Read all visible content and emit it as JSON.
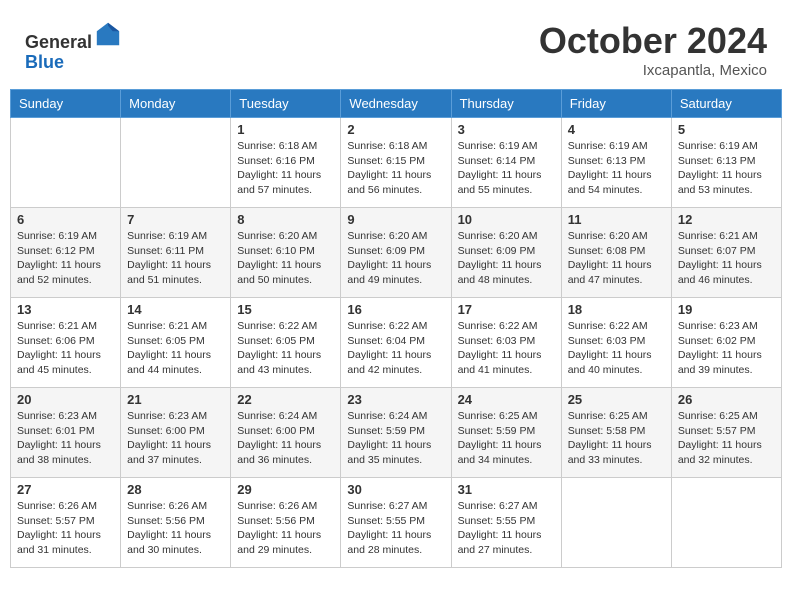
{
  "header": {
    "logo_general": "General",
    "logo_blue": "Blue",
    "month_title": "October 2024",
    "location": "Ixcapantla, Mexico"
  },
  "days_of_week": [
    "Sunday",
    "Monday",
    "Tuesday",
    "Wednesday",
    "Thursday",
    "Friday",
    "Saturday"
  ],
  "weeks": [
    [
      null,
      null,
      {
        "day": "1",
        "sunrise": "6:18 AM",
        "sunset": "6:16 PM",
        "daylight": "11 hours and 57 minutes."
      },
      {
        "day": "2",
        "sunrise": "6:18 AM",
        "sunset": "6:15 PM",
        "daylight": "11 hours and 56 minutes."
      },
      {
        "day": "3",
        "sunrise": "6:19 AM",
        "sunset": "6:14 PM",
        "daylight": "11 hours and 55 minutes."
      },
      {
        "day": "4",
        "sunrise": "6:19 AM",
        "sunset": "6:13 PM",
        "daylight": "11 hours and 54 minutes."
      },
      {
        "day": "5",
        "sunrise": "6:19 AM",
        "sunset": "6:13 PM",
        "daylight": "11 hours and 53 minutes."
      }
    ],
    [
      {
        "day": "6",
        "sunrise": "6:19 AM",
        "sunset": "6:12 PM",
        "daylight": "11 hours and 52 minutes."
      },
      {
        "day": "7",
        "sunrise": "6:19 AM",
        "sunset": "6:11 PM",
        "daylight": "11 hours and 51 minutes."
      },
      {
        "day": "8",
        "sunrise": "6:20 AM",
        "sunset": "6:10 PM",
        "daylight": "11 hours and 50 minutes."
      },
      {
        "day": "9",
        "sunrise": "6:20 AM",
        "sunset": "6:09 PM",
        "daylight": "11 hours and 49 minutes."
      },
      {
        "day": "10",
        "sunrise": "6:20 AM",
        "sunset": "6:09 PM",
        "daylight": "11 hours and 48 minutes."
      },
      {
        "day": "11",
        "sunrise": "6:20 AM",
        "sunset": "6:08 PM",
        "daylight": "11 hours and 47 minutes."
      },
      {
        "day": "12",
        "sunrise": "6:21 AM",
        "sunset": "6:07 PM",
        "daylight": "11 hours and 46 minutes."
      }
    ],
    [
      {
        "day": "13",
        "sunrise": "6:21 AM",
        "sunset": "6:06 PM",
        "daylight": "11 hours and 45 minutes."
      },
      {
        "day": "14",
        "sunrise": "6:21 AM",
        "sunset": "6:05 PM",
        "daylight": "11 hours and 44 minutes."
      },
      {
        "day": "15",
        "sunrise": "6:22 AM",
        "sunset": "6:05 PM",
        "daylight": "11 hours and 43 minutes."
      },
      {
        "day": "16",
        "sunrise": "6:22 AM",
        "sunset": "6:04 PM",
        "daylight": "11 hours and 42 minutes."
      },
      {
        "day": "17",
        "sunrise": "6:22 AM",
        "sunset": "6:03 PM",
        "daylight": "11 hours and 41 minutes."
      },
      {
        "day": "18",
        "sunrise": "6:22 AM",
        "sunset": "6:03 PM",
        "daylight": "11 hours and 40 minutes."
      },
      {
        "day": "19",
        "sunrise": "6:23 AM",
        "sunset": "6:02 PM",
        "daylight": "11 hours and 39 minutes."
      }
    ],
    [
      {
        "day": "20",
        "sunrise": "6:23 AM",
        "sunset": "6:01 PM",
        "daylight": "11 hours and 38 minutes."
      },
      {
        "day": "21",
        "sunrise": "6:23 AM",
        "sunset": "6:00 PM",
        "daylight": "11 hours and 37 minutes."
      },
      {
        "day": "22",
        "sunrise": "6:24 AM",
        "sunset": "6:00 PM",
        "daylight": "11 hours and 36 minutes."
      },
      {
        "day": "23",
        "sunrise": "6:24 AM",
        "sunset": "5:59 PM",
        "daylight": "11 hours and 35 minutes."
      },
      {
        "day": "24",
        "sunrise": "6:25 AM",
        "sunset": "5:59 PM",
        "daylight": "11 hours and 34 minutes."
      },
      {
        "day": "25",
        "sunrise": "6:25 AM",
        "sunset": "5:58 PM",
        "daylight": "11 hours and 33 minutes."
      },
      {
        "day": "26",
        "sunrise": "6:25 AM",
        "sunset": "5:57 PM",
        "daylight": "11 hours and 32 minutes."
      }
    ],
    [
      {
        "day": "27",
        "sunrise": "6:26 AM",
        "sunset": "5:57 PM",
        "daylight": "11 hours and 31 minutes."
      },
      {
        "day": "28",
        "sunrise": "6:26 AM",
        "sunset": "5:56 PM",
        "daylight": "11 hours and 30 minutes."
      },
      {
        "day": "29",
        "sunrise": "6:26 AM",
        "sunset": "5:56 PM",
        "daylight": "11 hours and 29 minutes."
      },
      {
        "day": "30",
        "sunrise": "6:27 AM",
        "sunset": "5:55 PM",
        "daylight": "11 hours and 28 minutes."
      },
      {
        "day": "31",
        "sunrise": "6:27 AM",
        "sunset": "5:55 PM",
        "daylight": "11 hours and 27 minutes."
      },
      null,
      null
    ]
  ],
  "labels": {
    "sunrise_prefix": "Sunrise: ",
    "sunset_prefix": "Sunset: ",
    "daylight_prefix": "Daylight: "
  }
}
